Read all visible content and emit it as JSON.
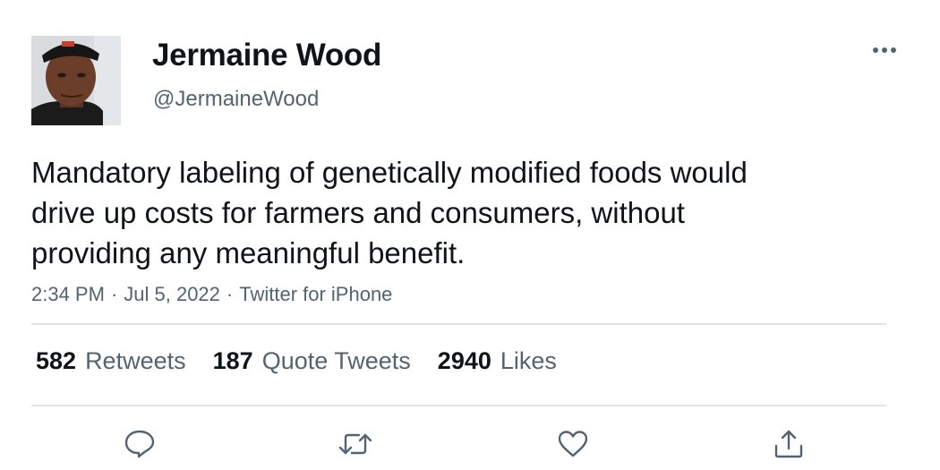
{
  "author": {
    "display_name": "Jermaine Wood",
    "handle": "@JermaineWood",
    "avatar_icon": "profile-photo"
  },
  "tweet": {
    "text": "Mandatory labeling of genetically modified foods would\ndrive up costs for farmers and consumers, without\nproviding any meaningful benefit.",
    "time": "2:34 PM",
    "date": "Jul 5, 2022",
    "source": "Twitter for iPhone",
    "separator": "·"
  },
  "stats": {
    "retweets_count": "582",
    "retweets_label": "Retweets",
    "quotes_count": "187",
    "quotes_label": "Quote Tweets",
    "likes_count": "2940",
    "likes_label": "Likes"
  },
  "actions": {
    "reply_icon": "reply-icon",
    "retweet_icon": "retweet-icon",
    "like_icon": "heart-icon",
    "share_icon": "share-icon",
    "more_icon": "more-icon"
  },
  "colors": {
    "text_primary": "#0f1419",
    "text_secondary": "#536471",
    "divider": "#e1e4e6"
  }
}
